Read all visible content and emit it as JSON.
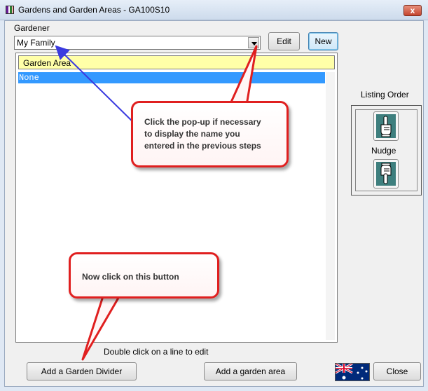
{
  "window": {
    "title": "Gardens and Garden Areas - GA100S10",
    "close_glyph": "x"
  },
  "gardener": {
    "label": "Gardener",
    "selected": "My Family",
    "edit_label": "Edit",
    "new_label": "New"
  },
  "garden_list": {
    "header": "Garden Area",
    "rows": [
      "None"
    ],
    "selected_color": "#3399ff"
  },
  "listing_order": {
    "label": "Listing Order",
    "nudge_label": "Nudge",
    "up_icon": "hand-pointing-up-icon",
    "down_icon": "hand-pointing-down-icon"
  },
  "hint": "Double click on  a line to edit",
  "buttons": {
    "add_divider": "Add a Garden Divider",
    "add_area": "Add a garden area",
    "close": "Close"
  },
  "flag_icon": "australia-flag-icon",
  "callouts": {
    "popup": {
      "line1": "Click the pop-up if necessary",
      "line2": "to display the name you",
      "line3": "entered in the previous steps"
    },
    "button": {
      "line1": "Now click on this button"
    },
    "border_color": "#e01f1f",
    "arrow_color": "#3a3ae0"
  }
}
